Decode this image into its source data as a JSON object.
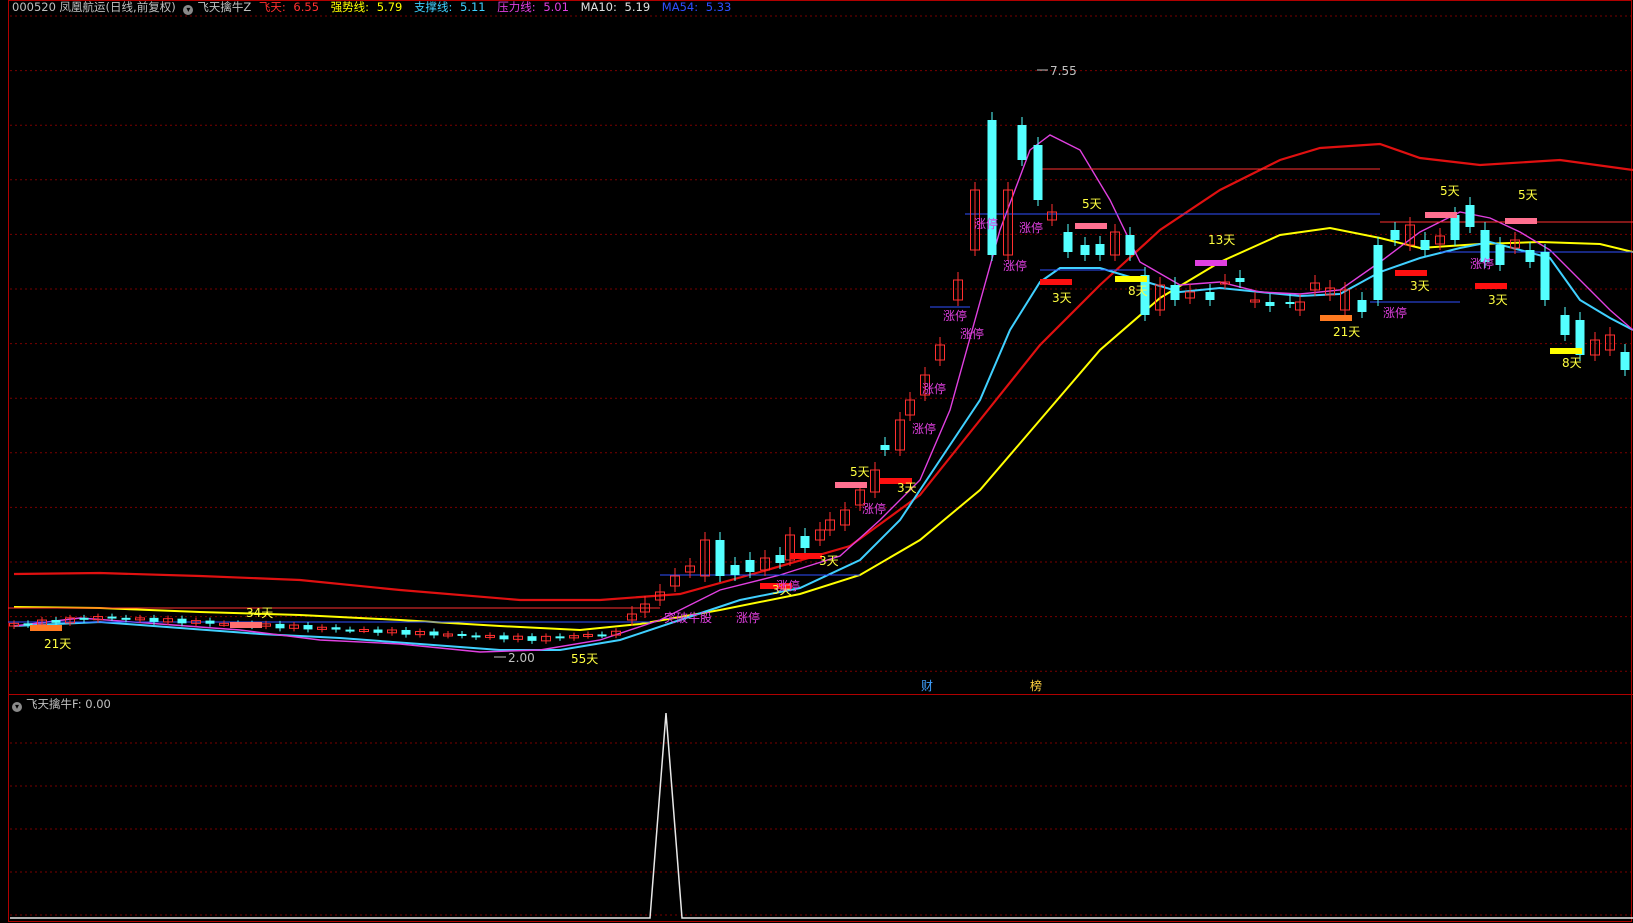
{
  "main_legend": {
    "code_name": "000520 凤凰航运(日线,前复权)",
    "indicator_name": "飞天擒牛Z",
    "items": [
      {
        "label": "飞天:",
        "value": "6.55",
        "color": "#ff3030"
      },
      {
        "label": "强势线:",
        "value": "5.79",
        "color": "#ffff00"
      },
      {
        "label": "支撑线:",
        "value": "5.11",
        "color": "#40d0ff"
      },
      {
        "label": "压力线:",
        "value": "5.01",
        "color": "#e040e0"
      },
      {
        "label": "MA10:",
        "value": "5.19",
        "color": "#e0e0e0"
      },
      {
        "label": "MA54:",
        "value": "5.33",
        "color": "#3050ff"
      }
    ]
  },
  "sub_legend": {
    "indicator_name": "飞天擒牛F",
    "value": ": 0.00"
  },
  "price_labels": {
    "high": "7.55",
    "low": "2.00"
  },
  "annotations": [
    {
      "text": "21天",
      "color": "#ffff40"
    },
    {
      "text": "34天",
      "color": "#ffff40"
    },
    {
      "text": "55天",
      "color": "#ffff40"
    },
    {
      "text": "突破牛股",
      "color": "#e040e0"
    },
    {
      "text": "涨停",
      "color": "#e040e0"
    },
    {
      "text": "3天",
      "color": "#ffff40"
    },
    {
      "text": "5天",
      "color": "#ffff40"
    },
    {
      "text": "8天",
      "color": "#ffff40"
    },
    {
      "text": "13天",
      "color": "#ffff40"
    },
    {
      "text": "财",
      "color": "#40a0ff"
    },
    {
      "text": "榜",
      "color": "#ffd040"
    }
  ],
  "colors": {
    "up": "#ff3030",
    "down": "#54ffff",
    "grid": "#7a0000",
    "border": "#b00000"
  }
}
